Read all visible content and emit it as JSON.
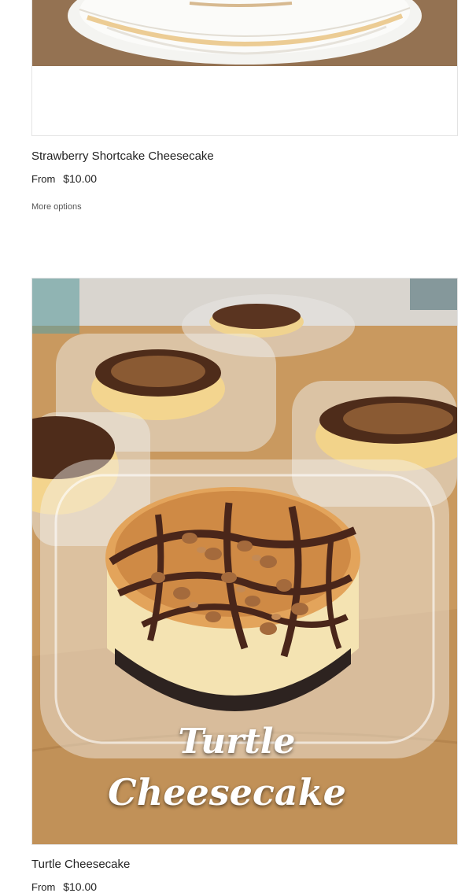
{
  "products": [
    {
      "name": "Strawberry Shortcake Cheesecake",
      "price_prefix": "From",
      "price": "$10.00",
      "more_options_label": "More options"
    },
    {
      "name": "Turtle Cheesecake",
      "price_prefix": "From",
      "price": "$10.00",
      "image_caption_line_1": "Turtle",
      "image_caption_line_2": "Cheesecake"
    }
  ],
  "colors": {
    "text": "#222222",
    "muted_text": "#555555",
    "border": "#e3e3e3"
  }
}
